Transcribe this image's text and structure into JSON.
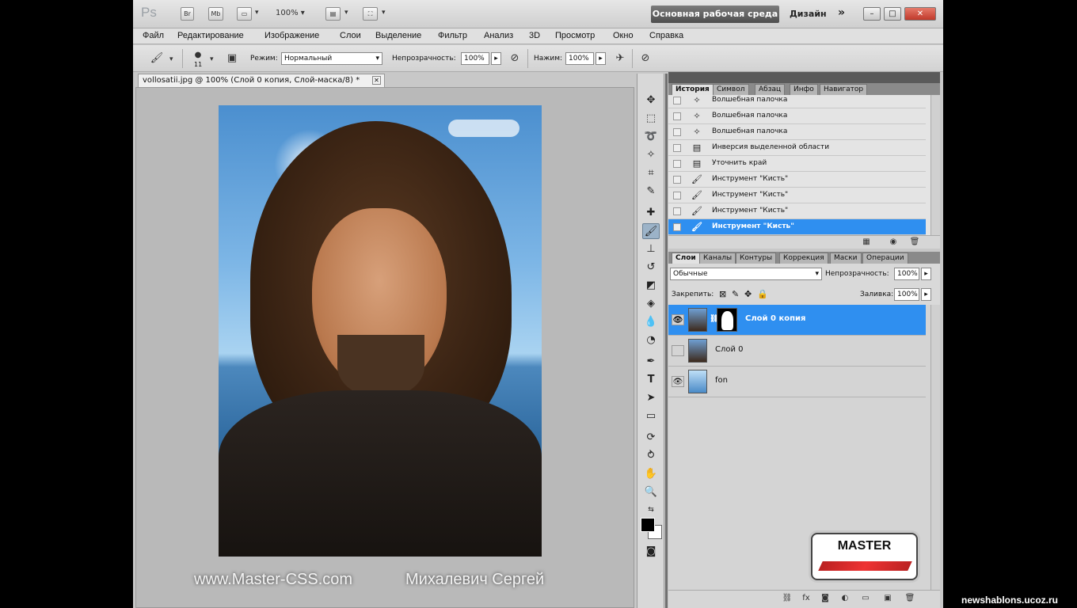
{
  "titlebar": {
    "app_logo": "Ps",
    "buttons": [
      "Br",
      "Mb"
    ],
    "zoom": "100%",
    "workspace_active": "Основная рабочая среда",
    "workspace_other": "Дизайн",
    "more": "»",
    "window_controls": [
      "–",
      "□",
      "✕"
    ]
  },
  "menu": [
    "Файл",
    "Редактирование",
    "Изображение",
    "Слои",
    "Выделение",
    "Фильтр",
    "Анализ",
    "3D",
    "Просмотр",
    "Окно",
    "Справка"
  ],
  "options": {
    "brush_size": "11",
    "mode_label": "Режим:",
    "mode_value": "Нормальный",
    "opacity_label": "Непрозрачность:",
    "opacity_value": "100%",
    "pressure_label": "Нажим:",
    "pressure_value": "100%"
  },
  "document": {
    "tab_title": "vollosatii.jpg @ 100% (Слой 0 копия, Слой-маска/8) *"
  },
  "watermark": {
    "site": "www.Master-CSS.com",
    "author": "Михалевич Сергей"
  },
  "history_panel": {
    "tabs": [
      "История",
      "Символ",
      "Абзац",
      "Инфо",
      "Навигатор"
    ],
    "rows": [
      {
        "label": "Волшебная палочка",
        "icon": "magic-wand"
      },
      {
        "label": "Волшебная палочка",
        "icon": "magic-wand"
      },
      {
        "label": "Волшебная палочка",
        "icon": "magic-wand"
      },
      {
        "label": "Инверсия выделенной области",
        "icon": "document"
      },
      {
        "label": "Уточнить край",
        "icon": "document"
      },
      {
        "label": "Инструмент \"Кисть\"",
        "icon": "brush"
      },
      {
        "label": "Инструмент \"Кисть\"",
        "icon": "brush"
      },
      {
        "label": "Инструмент \"Кисть\"",
        "icon": "brush"
      },
      {
        "label": "Инструмент \"Кисть\"",
        "icon": "brush",
        "selected": true
      }
    ]
  },
  "layers_panel": {
    "tabs": [
      "Слои",
      "Каналы",
      "Контуры",
      "Коррекция",
      "Маски",
      "Операции"
    ],
    "blend_mode": "Обычные",
    "opacity_label": "Непрозрачность:",
    "opacity_value": "100%",
    "lock_label": "Закрепить:",
    "fill_label": "Заливка:",
    "fill_value": "100%",
    "layers": [
      {
        "name": "Слой 0 копия",
        "visible": true,
        "has_mask": true,
        "selected": true
      },
      {
        "name": "Слой 0",
        "visible": false,
        "has_mask": false,
        "selected": false
      },
      {
        "name": "fon",
        "visible": true,
        "has_mask": false,
        "selected": false
      }
    ]
  },
  "logo": {
    "text": "MASTER"
  },
  "site_tag": "newshablons.ucoz.ru",
  "colors": {
    "selection": "#2f8ff0",
    "workspace_button": "#5e5e5e"
  }
}
